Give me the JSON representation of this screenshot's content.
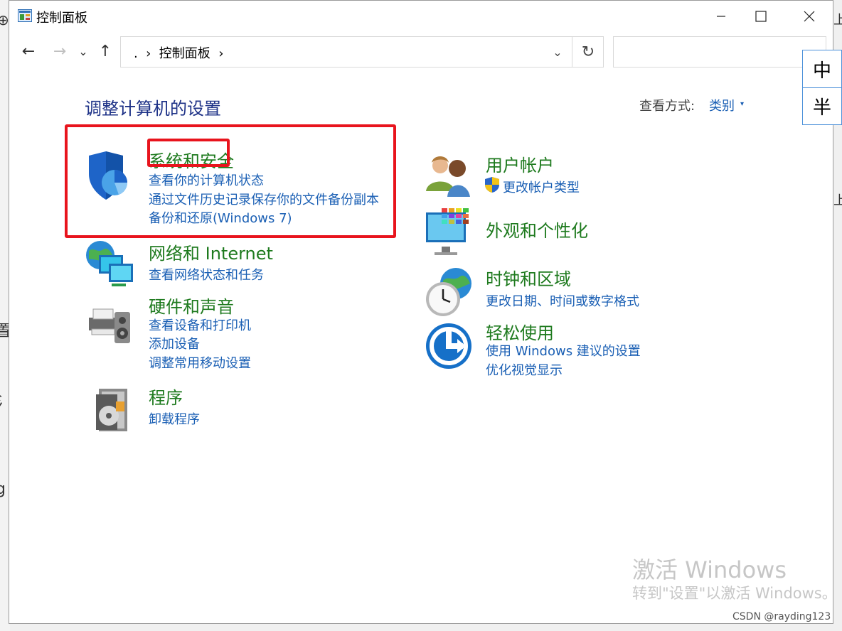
{
  "window": {
    "title": "控制面板"
  },
  "titlebar": {
    "minimize": "—",
    "maximize": "☐",
    "close": "✕"
  },
  "nav": {
    "back": "←",
    "forward": "→",
    "recent": "⌄",
    "up": "↑",
    "address_text": ".  ›  控制面板  ›",
    "address_dropdown": "⌄",
    "refresh": "↻",
    "search_placeholder": ""
  },
  "ime": {
    "mode": "中",
    "width": "半"
  },
  "main": {
    "heading": "调整计算机的设置",
    "view_by_label": "查看方式:",
    "view_by_value": "类别",
    "view_by_arrow": "▾"
  },
  "categories_left": [
    {
      "title": "系统和安全",
      "links": [
        "查看你的计算机状态",
        "通过文件历史记录保存你的文件备份副本",
        "备份和还原(Windows 7)"
      ]
    },
    {
      "title": "网络和 Internet",
      "links": [
        "查看网络状态和任务"
      ]
    },
    {
      "title": "硬件和声音",
      "links": [
        "查看设备和打印机",
        "添加设备",
        "调整常用移动设置"
      ]
    },
    {
      "title": "程序",
      "links": [
        "卸载程序"
      ]
    }
  ],
  "categories_right": [
    {
      "title": "用户帐户",
      "links": [
        "更改帐户类型"
      ]
    },
    {
      "title": "外观和个性化",
      "links": []
    },
    {
      "title": "时钟和区域",
      "links": [
        "更改日期、时间或数字格式"
      ]
    },
    {
      "title": "轻松使用",
      "links": [
        "使用 Windows 建议的设置",
        "优化视觉显示"
      ]
    }
  ],
  "watermark": {
    "line1": "激活 Windows",
    "line2": "转到\"设置\"以激活 Windows。"
  },
  "csdn": "CSDN @rayding123",
  "background_fragments": [
    "⊕",
    "置",
    "氵",
    "g",
    "上",
    "上"
  ],
  "colors": {
    "accent_link": "#1a5fb4",
    "category_title": "#1e7a1e",
    "heading": "#1e3287",
    "highlight": "#e8141d"
  }
}
